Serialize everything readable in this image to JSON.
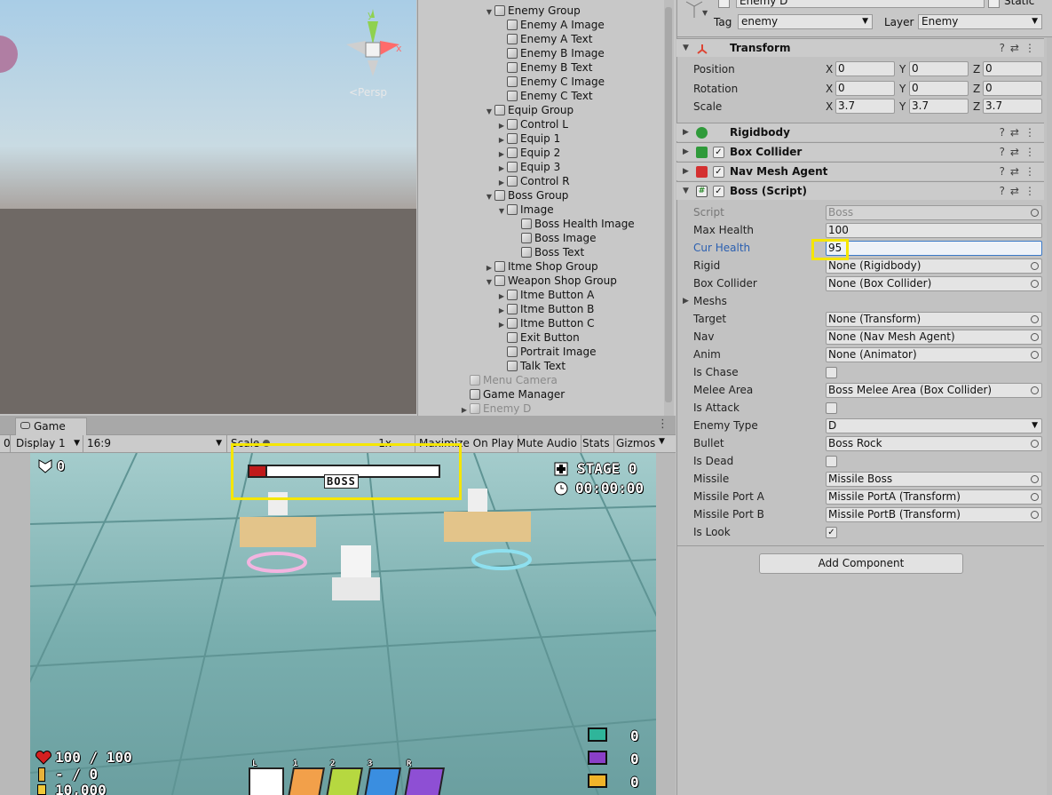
{
  "scene": {
    "persp_label": "<Persp"
  },
  "hierarchy": {
    "items": [
      {
        "label": "Enemy Group",
        "indent": 2,
        "arrow": "down",
        "dim": false
      },
      {
        "label": "Enemy A Image",
        "indent": 3,
        "arrow": "",
        "dim": false
      },
      {
        "label": "Enemy A Text",
        "indent": 3,
        "arrow": "",
        "dim": false
      },
      {
        "label": "Enemy B Image",
        "indent": 3,
        "arrow": "",
        "dim": false
      },
      {
        "label": "Enemy B Text",
        "indent": 3,
        "arrow": "",
        "dim": false
      },
      {
        "label": "Enemy C Image",
        "indent": 3,
        "arrow": "",
        "dim": false
      },
      {
        "label": "Enemy C Text",
        "indent": 3,
        "arrow": "",
        "dim": false
      },
      {
        "label": "Equip Group",
        "indent": 2,
        "arrow": "down",
        "dim": false
      },
      {
        "label": "Control L",
        "indent": 3,
        "arrow": "right",
        "dim": false
      },
      {
        "label": "Equip 1",
        "indent": 3,
        "arrow": "right",
        "dim": false
      },
      {
        "label": "Equip 2",
        "indent": 3,
        "arrow": "right",
        "dim": false
      },
      {
        "label": "Equip 3",
        "indent": 3,
        "arrow": "right",
        "dim": false
      },
      {
        "label": "Control R",
        "indent": 3,
        "arrow": "right",
        "dim": false
      },
      {
        "label": "Boss Group",
        "indent": 2,
        "arrow": "down",
        "dim": false
      },
      {
        "label": "Image",
        "indent": 3,
        "arrow": "down",
        "dim": false
      },
      {
        "label": "Boss Health Image",
        "indent": 4,
        "arrow": "",
        "dim": false
      },
      {
        "label": "Boss Image",
        "indent": 4,
        "arrow": "",
        "dim": false
      },
      {
        "label": "Boss Text",
        "indent": 4,
        "arrow": "",
        "dim": false
      },
      {
        "label": "Itme Shop Group",
        "indent": 2,
        "arrow": "right",
        "dim": false
      },
      {
        "label": "Weapon Shop Group",
        "indent": 2,
        "arrow": "down",
        "dim": false
      },
      {
        "label": "Itme Button A",
        "indent": 3,
        "arrow": "right",
        "dim": false
      },
      {
        "label": "Itme Button B",
        "indent": 3,
        "arrow": "right",
        "dim": false
      },
      {
        "label": "Itme Button C",
        "indent": 3,
        "arrow": "right",
        "dim": false
      },
      {
        "label": "Exit Button",
        "indent": 3,
        "arrow": "",
        "dim": false
      },
      {
        "label": "Portrait Image",
        "indent": 3,
        "arrow": "",
        "dim": false
      },
      {
        "label": "Talk Text",
        "indent": 3,
        "arrow": "",
        "dim": false
      },
      {
        "label": "Menu Camera",
        "indent": 0,
        "arrow": "",
        "dim": true
      },
      {
        "label": "Game Manager",
        "indent": 0,
        "arrow": "",
        "dim": false
      },
      {
        "label": "Enemy D",
        "indent": 0,
        "arrow": "right",
        "dim": true
      }
    ]
  },
  "game": {
    "tab_label": "Game",
    "display": "Display 1",
    "aspect": "16:9",
    "scale_label": "Scale",
    "scale_value": "1x",
    "maximize": "Maximize On Play",
    "mute": "Mute Audio",
    "stats": "Stats",
    "gizmos": "Gizmos",
    "left_num": "0",
    "hud": {
      "score": "0",
      "boss_label": "BOSS",
      "stage": "STAGE 0",
      "time": "00:00:00",
      "health": "100 / 100",
      "ammo": "- / 0",
      "coin": "10,000",
      "enemy_a": "0",
      "enemy_b": "0",
      "enemy_c": "0",
      "slot_l": "L",
      "slot_1": "1",
      "slot_2": "2",
      "slot_3": "3",
      "slot_r": "R"
    }
  },
  "inspector": {
    "name": "Enemy D",
    "static_label": "Static",
    "tag_label": "Tag",
    "tag_value": "enemy",
    "layer_label": "Layer",
    "layer_value": "Enemy",
    "components": {
      "transform": "Transform",
      "rigidbody": "Rigidbody",
      "box_collider": "Box Collider",
      "nav_mesh_agent": "Nav Mesh Agent",
      "boss_script": "Boss (Script)"
    },
    "transform": {
      "position_label": "Position",
      "rotation_label": "Rotation",
      "scale_label": "Scale",
      "position": [
        "0",
        "0",
        "0"
      ],
      "rotation": [
        "0",
        "0",
        "0"
      ],
      "scale": [
        "3.7",
        "3.7",
        "3.7"
      ]
    },
    "fields": [
      {
        "label": "Script",
        "value": "Boss",
        "dot": true
      },
      {
        "label": "Max Health",
        "value": "100",
        "dot": false
      },
      {
        "label": "Cur Health",
        "value": "95",
        "dot": false
      },
      {
        "label": "Rigid",
        "value": "None (Rigidbody)",
        "dot": true
      },
      {
        "label": "Box Collider",
        "value": "None (Box Collider)",
        "dot": true
      },
      {
        "label": "Meshs",
        "value": "",
        "dot": false
      },
      {
        "label": "Target",
        "value": "None (Transform)",
        "dot": true
      },
      {
        "label": "Nav",
        "value": "None (Nav Mesh Agent)",
        "dot": true
      },
      {
        "label": "Anim",
        "value": "None (Animator)",
        "dot": true
      },
      {
        "label": "Is Chase",
        "value": "",
        "dot": false
      },
      {
        "label": "Melee Area",
        "value": "Boss Melee Area (Box Collider)",
        "dot": true
      },
      {
        "label": "Is Attack",
        "value": "",
        "dot": false
      },
      {
        "label": "Enemy Type",
        "value": "D",
        "dot": false
      },
      {
        "label": "Bullet",
        "value": "Boss Rock",
        "dot": true
      },
      {
        "label": "Is Dead",
        "value": "",
        "dot": false
      },
      {
        "label": "Missile",
        "value": "Missile Boss",
        "dot": true
      },
      {
        "label": "Missile Port A",
        "value": "Missile PortA (Transform)",
        "dot": true
      },
      {
        "label": "Missile Port B",
        "value": "Missile PortB (Transform)",
        "dot": true
      },
      {
        "label": "Is Look",
        "value": "",
        "dot": false
      }
    ],
    "add_component": "Add Component"
  },
  "colors": {
    "highlight": "#f5e600",
    "link_label": "#2a5fb0"
  }
}
